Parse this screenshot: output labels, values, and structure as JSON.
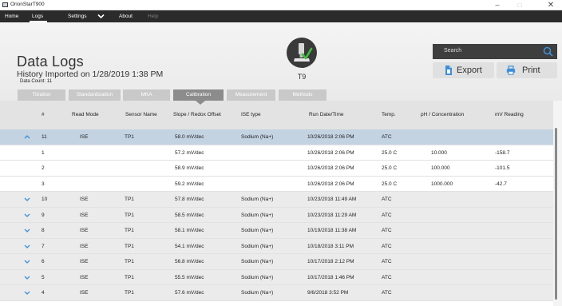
{
  "window": {
    "title": "OrionStarT900",
    "minimize": "–",
    "maximize": "□",
    "close": "✕"
  },
  "nav": {
    "home": "Home",
    "logs": "Logs",
    "settings": "Settings",
    "about": "About",
    "help": "Help"
  },
  "header": {
    "title": "Data Logs",
    "import_info": "History Imported on 1/28/2019 1:38 PM",
    "data_count_label": "Data Count: ",
    "data_count_value": "11",
    "device_label": "T9"
  },
  "search": {
    "placeholder": "Search"
  },
  "actions": {
    "export_label": "Export",
    "print_label": "Print"
  },
  "tabs": [
    {
      "label": "Titration"
    },
    {
      "label": "Standardization"
    },
    {
      "label": "MKA"
    },
    {
      "label": "Calibration",
      "active": true
    },
    {
      "label": "Measurement"
    },
    {
      "label": "Methods"
    }
  ],
  "table": {
    "columns": [
      "#",
      "Read Mode",
      "Sensor Name",
      "Slope / Redox Offset",
      "ISE type",
      "Run Date/Time",
      "Temp.",
      "pH / Concentration",
      "mV Reading"
    ],
    "rows": [
      {
        "kind": "expanded",
        "num": "11",
        "mode": "ISE",
        "sensor": "TP1",
        "slope": "58.0 mV/dec",
        "ise": "Sodium (Na+)",
        "run": "10/26/2018 2:06 PM",
        "temp": "ATC",
        "ph": "",
        "mv": ""
      },
      {
        "kind": "child",
        "num": "1",
        "mode": "",
        "sensor": "",
        "slope": "57.2 mV/dec",
        "ise": "",
        "run": "10/26/2018 2:06 PM",
        "temp": "25.0 C",
        "ph": "10.000",
        "mv": "-158.7"
      },
      {
        "kind": "child",
        "num": "2",
        "mode": "",
        "sensor": "",
        "slope": "58.9 mV/dec",
        "ise": "",
        "run": "10/26/2018 2:06 PM",
        "temp": "25.0 C",
        "ph": "100.000",
        "mv": "-101.5"
      },
      {
        "kind": "child",
        "num": "3",
        "mode": "",
        "sensor": "",
        "slope": "59.2 mV/dec",
        "ise": "",
        "run": "10/26/2018 2:06 PM",
        "temp": "25.0 C",
        "ph": "1000.000",
        "mv": "-42.7"
      },
      {
        "kind": "parent",
        "num": "10",
        "mode": "ISE",
        "sensor": "TP1",
        "slope": "57.8 mV/dec",
        "ise": "Sodium (Na+)",
        "run": "10/23/2018 11:49 AM",
        "temp": "ATC",
        "ph": "",
        "mv": ""
      },
      {
        "kind": "parent",
        "num": "9",
        "mode": "ISE",
        "sensor": "TP1",
        "slope": "58.5 mV/dec",
        "ise": "Sodium (Na+)",
        "run": "10/23/2018 11:29 AM",
        "temp": "ATC",
        "ph": "",
        "mv": ""
      },
      {
        "kind": "parent",
        "num": "8",
        "mode": "ISE",
        "sensor": "TP1",
        "slope": "58.1 mV/dec",
        "ise": "Sodium (Na+)",
        "run": "10/19/2018 11:38 AM",
        "temp": "ATC",
        "ph": "",
        "mv": ""
      },
      {
        "kind": "parent",
        "num": "7",
        "mode": "ISE",
        "sensor": "TP1",
        "slope": "54.1 mV/dec",
        "ise": "Sodium (Na+)",
        "run": "10/18/2018 3:11 PM",
        "temp": "ATC",
        "ph": "",
        "mv": ""
      },
      {
        "kind": "parent",
        "num": "6",
        "mode": "ISE",
        "sensor": "TP1",
        "slope": "56.8 mV/dec",
        "ise": "Sodium (Na+)",
        "run": "10/17/2018 2:12 PM",
        "temp": "ATC",
        "ph": "",
        "mv": ""
      },
      {
        "kind": "parent",
        "num": "5",
        "mode": "ISE",
        "sensor": "TP1",
        "slope": "55.5 mV/dec",
        "ise": "Sodium (Na+)",
        "run": "10/17/2018 1:46 PM",
        "temp": "ATC",
        "ph": "",
        "mv": ""
      },
      {
        "kind": "parent",
        "num": "4",
        "mode": "ISE",
        "sensor": "TP1",
        "slope": "57.6 mV/dec",
        "ise": "Sodium (Na+)",
        "run": "9/6/2018 3:52 PM",
        "temp": "ATC",
        "ph": "",
        "mv": ""
      }
    ]
  },
  "colors": {
    "accent": "#3d8fd6",
    "nav_bg": "#2b2b2b",
    "selected_row": "#c3d3e2",
    "check": "#3fbf3f"
  },
  "icons": {
    "app": "app-window-icon",
    "search": "search-icon",
    "export": "export-file-icon",
    "print": "printer-icon",
    "device": "electrode-device-icon",
    "expand": "chevron-icon"
  }
}
